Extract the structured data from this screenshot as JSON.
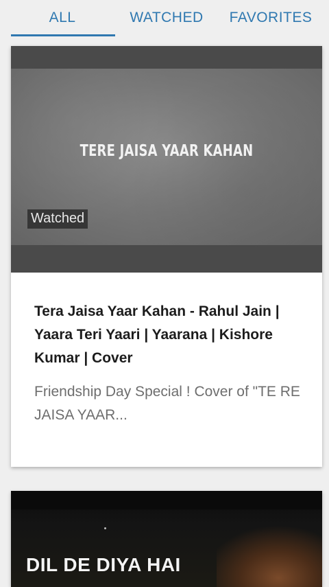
{
  "tabs": {
    "all": "ALL",
    "watched": "WATCHED",
    "favorites": "FAVORITES",
    "selected": "ALL",
    "accent_color": "#2f78b0"
  },
  "videos": [
    {
      "thumbnail_text": "TERE JAISA YAAR KAHAN",
      "badge": "Watched",
      "title": "Tera Jaisa Yaar Kahan - Rahul Jain | Yaara Teri Yaari | Yaarana | Kishore Kumar | Cover",
      "description": "Friendship Day Special ! Cover of \"TE RE JAISA YAAR..."
    },
    {
      "thumbnail_text": "DIL DE DIYA HAI"
    }
  ]
}
